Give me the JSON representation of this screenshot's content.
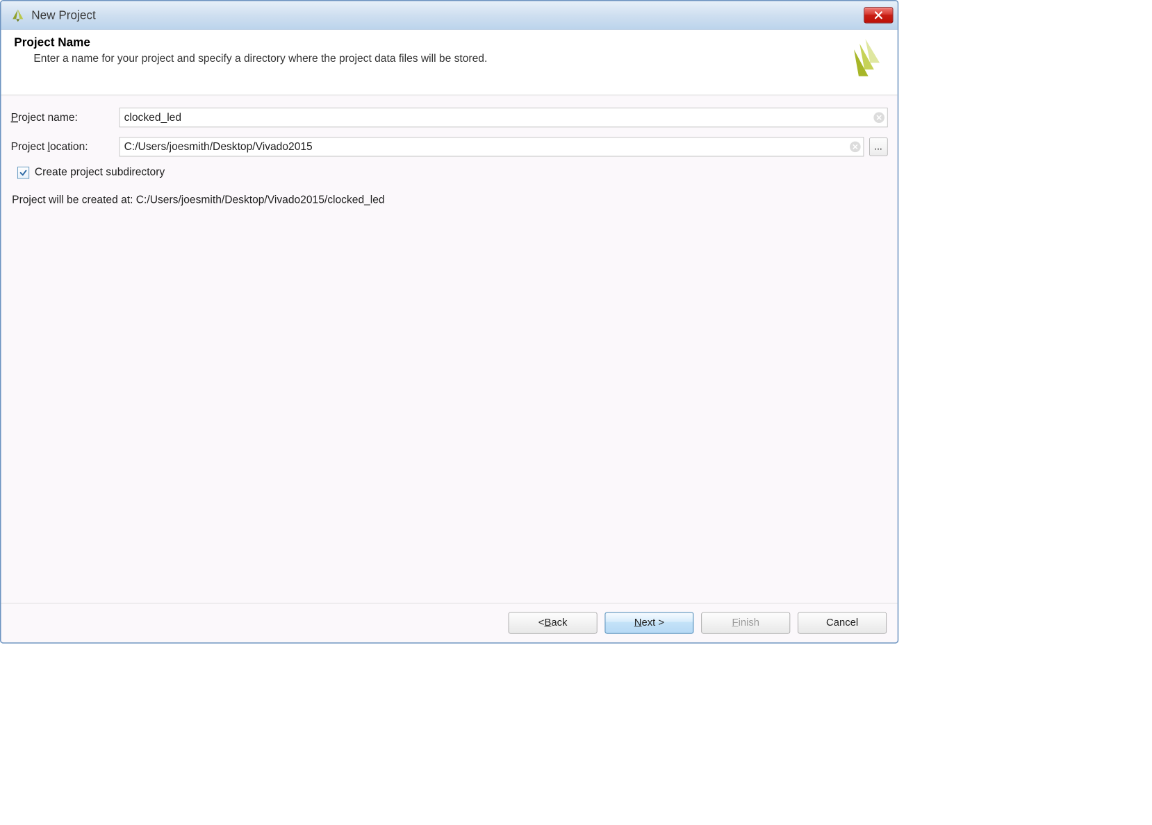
{
  "window": {
    "title": "New Project"
  },
  "header": {
    "heading": "Project Name",
    "subtext": "Enter a name for your project and specify a directory where the project data files will be stored."
  },
  "form": {
    "name_label_pre": "P",
    "name_label_rest": "roject name:",
    "location_label_pre": "Project ",
    "location_label_u": "l",
    "location_label_rest": "ocation:",
    "name_value": "clocked_led",
    "location_value": "C:/Users/joesmith/Desktop/Vivado2015",
    "browse_label": "...",
    "create_subdir_label": "Create project subdirectory",
    "create_subdir_checked": true,
    "summary": "Project will be created at: C:/Users/joesmith/Desktop/Vivado2015/clocked_led"
  },
  "footer": {
    "back_pre": "< ",
    "back_u": "B",
    "back_rest": "ack",
    "next_u": "N",
    "next_rest": "ext >",
    "finish_u": "F",
    "finish_rest": "inish",
    "cancel": "Cancel"
  }
}
